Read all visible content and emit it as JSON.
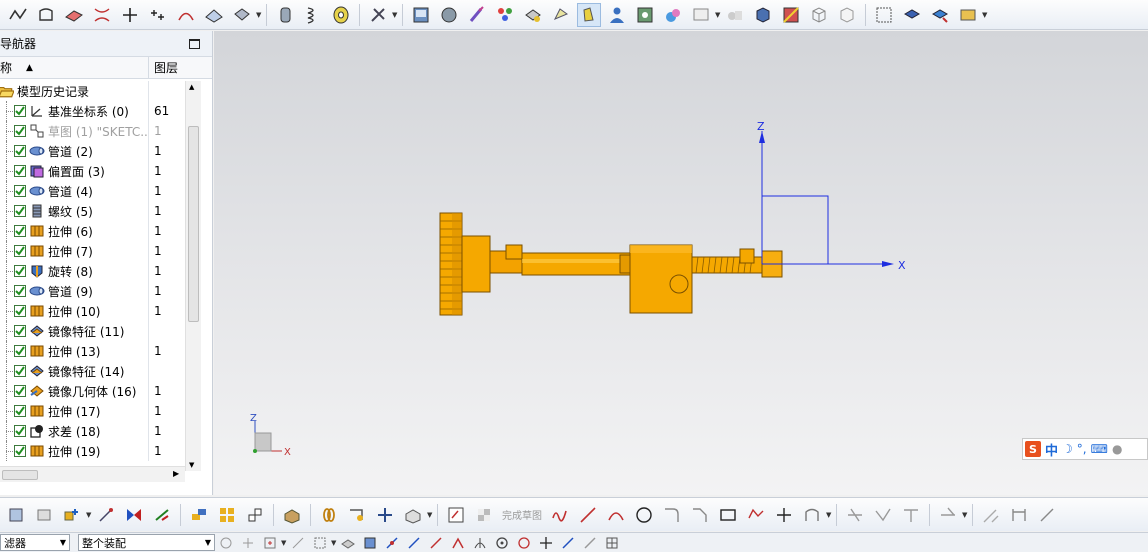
{
  "navigator": {
    "title": "导航器",
    "column_name": "称",
    "column_layer": "图层",
    "root_label": "模型历史记录",
    "rows": [
      {
        "label": "基准坐标系 (0)",
        "layer": "61",
        "icon": "datum-csys-icon",
        "dim": false
      },
      {
        "label": "草图 (1) \"SKETC...",
        "layer": "1",
        "icon": "sketch-icon",
        "dim": true
      },
      {
        "label": "管道 (2)",
        "layer": "1",
        "icon": "tube-icon",
        "dim": false
      },
      {
        "label": "偏置面 (3)",
        "layer": "1",
        "icon": "offset-face-icon",
        "dim": false
      },
      {
        "label": "管道 (4)",
        "layer": "1",
        "icon": "tube-icon",
        "dim": false
      },
      {
        "label": "螺纹 (5)",
        "layer": "1",
        "icon": "thread-icon",
        "dim": false
      },
      {
        "label": "拉伸 (6)",
        "layer": "1",
        "icon": "extrude-icon",
        "dim": false
      },
      {
        "label": "拉伸 (7)",
        "layer": "1",
        "icon": "extrude-icon",
        "dim": false
      },
      {
        "label": "旋转 (8)",
        "layer": "1",
        "icon": "revolve-icon",
        "dim": false
      },
      {
        "label": "管道 (9)",
        "layer": "1",
        "icon": "tube-icon",
        "dim": false
      },
      {
        "label": "拉伸 (10)",
        "layer": "1",
        "icon": "extrude-icon",
        "dim": false
      },
      {
        "label": "镜像特征 (11)",
        "layer": "",
        "icon": "mirror-feature-icon",
        "dim": false
      },
      {
        "label": "拉伸 (13)",
        "layer": "1",
        "icon": "extrude-icon",
        "dim": false
      },
      {
        "label": "镜像特征 (14)",
        "layer": "",
        "icon": "mirror-feature-icon",
        "dim": false
      },
      {
        "label": "镜像几何体 (16)",
        "layer": "1",
        "icon": "mirror-geometry-icon",
        "dim": false
      },
      {
        "label": "拉伸 (17)",
        "layer": "1",
        "icon": "extrude-icon",
        "dim": false
      },
      {
        "label": "求差 (18)",
        "layer": "1",
        "icon": "subtract-icon",
        "dim": false
      },
      {
        "label": "拉伸 (19)",
        "layer": "1",
        "icon": "extrude-icon",
        "dim": false
      }
    ]
  },
  "viewport": {
    "axis_x": "X",
    "axis_z": "Z",
    "mini_axis_x": "X",
    "mini_axis_z": "Z",
    "ime_label": "中"
  },
  "bottom_toolbar": {
    "finish_sketch_label": "完成草图"
  },
  "selection_bar": {
    "filter_label": "滤器",
    "scope_label": "整个装配"
  },
  "colors": {
    "part": "#f5a800",
    "part_dark": "#b57400",
    "axis": "#1e2ee0",
    "check": "#1f8f1f"
  }
}
